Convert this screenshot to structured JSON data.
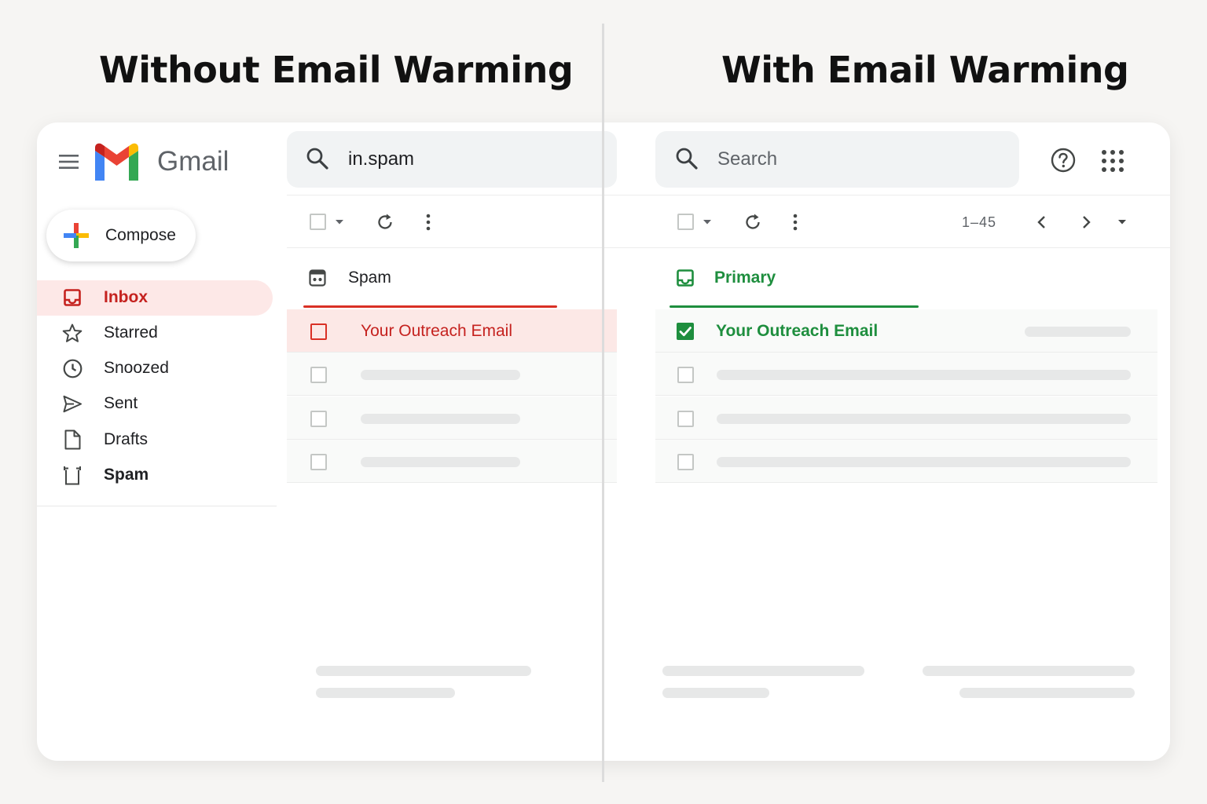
{
  "headings": {
    "left": "Without Email Warming",
    "right": "With Email Warming"
  },
  "app": {
    "name": "Gmail"
  },
  "sidebar": {
    "compose_label": "Compose",
    "items": [
      {
        "label": "Inbox",
        "icon": "inbox-icon",
        "active": true
      },
      {
        "label": "Starred",
        "icon": "star-icon"
      },
      {
        "label": "Snoozed",
        "icon": "clock-icon"
      },
      {
        "label": "Sent",
        "icon": "send-icon"
      },
      {
        "label": "Drafts",
        "icon": "draft-icon"
      },
      {
        "label": "Spam",
        "icon": "spam-icon",
        "bold": true
      }
    ]
  },
  "left_panel": {
    "search_value": "in.spam",
    "tab_label": "Spam",
    "email_subject": "Your Outreach Email",
    "accent_color": "#d93025"
  },
  "right_panel": {
    "search_placeholder": "Search",
    "pagination": "1–45",
    "tab_label": "Primary",
    "email_subject": "Your Outreach Email",
    "email_checked": true,
    "accent_color": "#1e8e3e"
  }
}
